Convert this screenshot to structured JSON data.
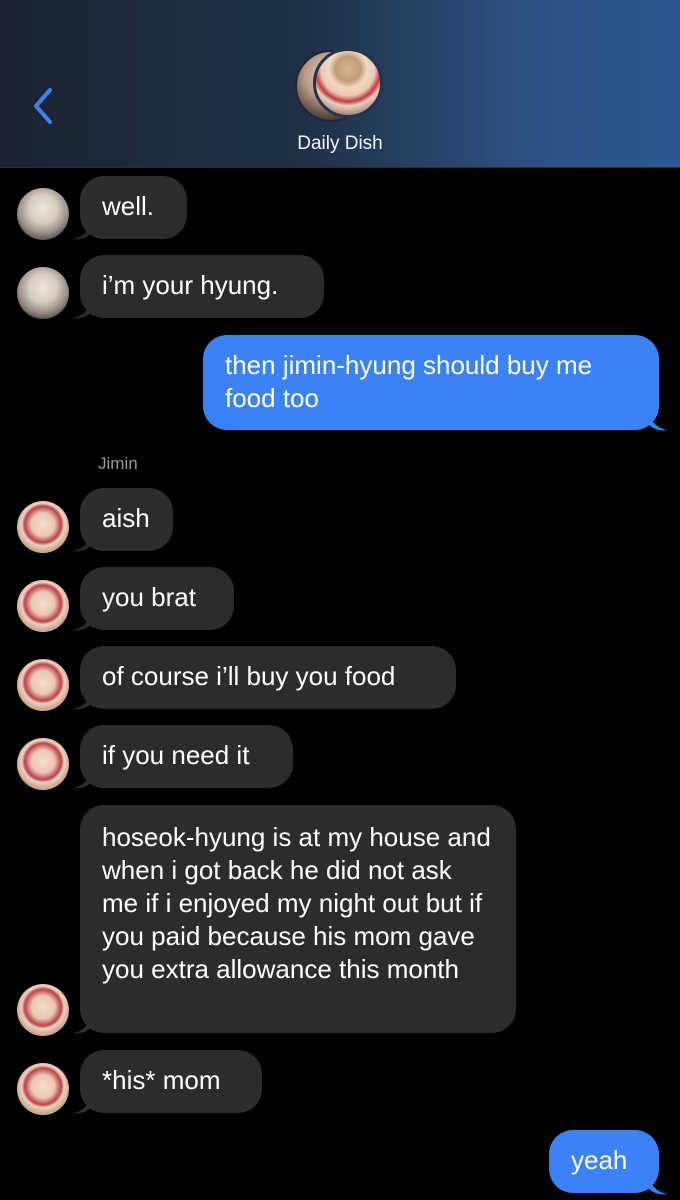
{
  "header": {
    "title": "Daily Dish"
  },
  "sender_label": "Jimin",
  "messages": [
    {
      "text": "well."
    },
    {
      "text": "i’m your hyung."
    },
    {
      "text": "then jimin-hyung should buy me food too"
    },
    {
      "text": "aish"
    },
    {
      "text": "you brat"
    },
    {
      "text": "of course i’ll buy you food"
    },
    {
      "text": "if you need it"
    },
    {
      "text": "hoseok-hyung is at my house and when i got back he did not ask me if i enjoyed my night out but if you paid because his mom gave you extra allowance this month"
    },
    {
      "text": "*his* mom"
    },
    {
      "text": "yeah"
    }
  ],
  "colors": {
    "incoming": "#2c2c2e",
    "outgoing": "#3b82f6",
    "background": "#000000",
    "accent": "#3b82f6"
  },
  "icons": {
    "back": "chevron-left-icon"
  }
}
